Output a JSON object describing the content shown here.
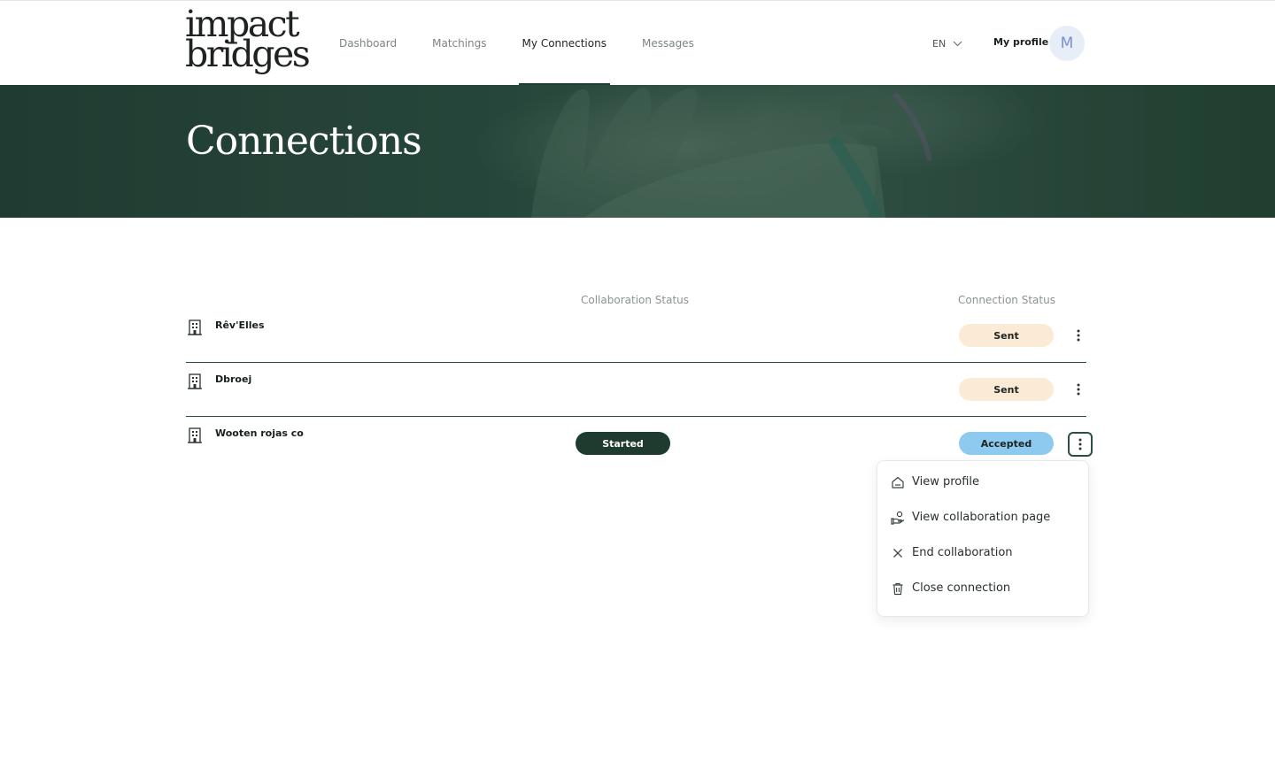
{
  "header": {
    "logo_line1": "impact",
    "logo_line2": "bridges",
    "nav": [
      {
        "label": "Dashboard",
        "active": false
      },
      {
        "label": "Matchings",
        "active": false
      },
      {
        "label": "My Connections",
        "active": true
      },
      {
        "label": "Messages",
        "active": false
      }
    ],
    "language": "EN",
    "my_profile_label": "My profile",
    "avatar_initial": "M"
  },
  "hero": {
    "title": "Connections"
  },
  "table": {
    "columns": {
      "collaboration_status": "Collaboration Status",
      "connection_status": "Connection Status"
    },
    "rows": [
      {
        "name": "Rêv'Elles",
        "collaboration_status": "",
        "connection_status": "Sent"
      },
      {
        "name": "Dbroej",
        "collaboration_status": "",
        "connection_status": "Sent"
      },
      {
        "name": "Wooten rojas co",
        "collaboration_status": "Started",
        "connection_status": "Accepted"
      }
    ]
  },
  "row_menu": {
    "open_for_row": "Wooten rojas co",
    "items": [
      {
        "label": "View profile",
        "icon": "home-icon"
      },
      {
        "label": "View collaboration page",
        "icon": "handshake-icon"
      },
      {
        "label": "End collaboration",
        "icon": "close-icon"
      },
      {
        "label": "Close connection",
        "icon": "trash-icon"
      }
    ]
  },
  "colors": {
    "brand_dark": "#1f3a2f",
    "sent_badge": "#fbebd6",
    "accepted_badge": "#8ecaf0",
    "avatar_bg": "#e8eef8"
  }
}
